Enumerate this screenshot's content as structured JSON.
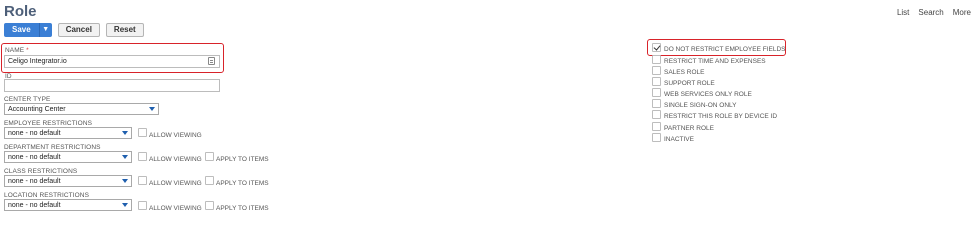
{
  "page": {
    "title": "Role",
    "nav": [
      "List",
      "Search",
      "More"
    ]
  },
  "toolbar": {
    "save_label": "Save",
    "save_dropdown_icon": "chevron-down-icon",
    "cancel_label": "Cancel",
    "reset_label": "Reset"
  },
  "form": {
    "name_label": "NAME",
    "name_required": "*",
    "name_value": "Celigo Integrator.io",
    "id_label": "ID",
    "id_value": "",
    "center_type_label": "CENTER TYPE",
    "center_type_value": "Accounting Center",
    "restrictions": [
      {
        "label": "EMPLOYEE RESTRICTIONS",
        "value": "none - no default",
        "allow_viewing": "ALLOW VIEWING",
        "apply_to_items": ""
      },
      {
        "label": "DEPARTMENT RESTRICTIONS",
        "value": "none - no default",
        "allow_viewing": "ALLOW VIEWING",
        "apply_to_items": "APPLY TO ITEMS"
      },
      {
        "label": "CLASS RESTRICTIONS",
        "value": "none - no default",
        "allow_viewing": "ALLOW VIEWING",
        "apply_to_items": "APPLY TO ITEMS"
      },
      {
        "label": "LOCATION RESTRICTIONS",
        "value": "none - no default",
        "allow_viewing": "ALLOW VIEWING",
        "apply_to_items": "APPLY TO ITEMS"
      }
    ]
  },
  "options": [
    {
      "label": "DO NOT RESTRICT EMPLOYEE FIELDS",
      "checked": true
    },
    {
      "label": "RESTRICT TIME AND EXPENSES",
      "checked": false
    },
    {
      "label": "SALES ROLE",
      "checked": false
    },
    {
      "label": "SUPPORT ROLE",
      "checked": false
    },
    {
      "label": "WEB SERVICES ONLY ROLE",
      "checked": false
    },
    {
      "label": "SINGLE SIGN-ON ONLY",
      "checked": false
    },
    {
      "label": "RESTRICT THIS ROLE BY DEVICE ID",
      "checked": false
    },
    {
      "label": "PARTNER ROLE",
      "checked": false
    },
    {
      "label": "INACTIVE",
      "checked": false
    }
  ],
  "colors": {
    "title": "#4d5f79",
    "primary_button": "#3b7fd5",
    "highlight_box": "#d8232a",
    "dropdown_arrow": "#1f5fae"
  }
}
